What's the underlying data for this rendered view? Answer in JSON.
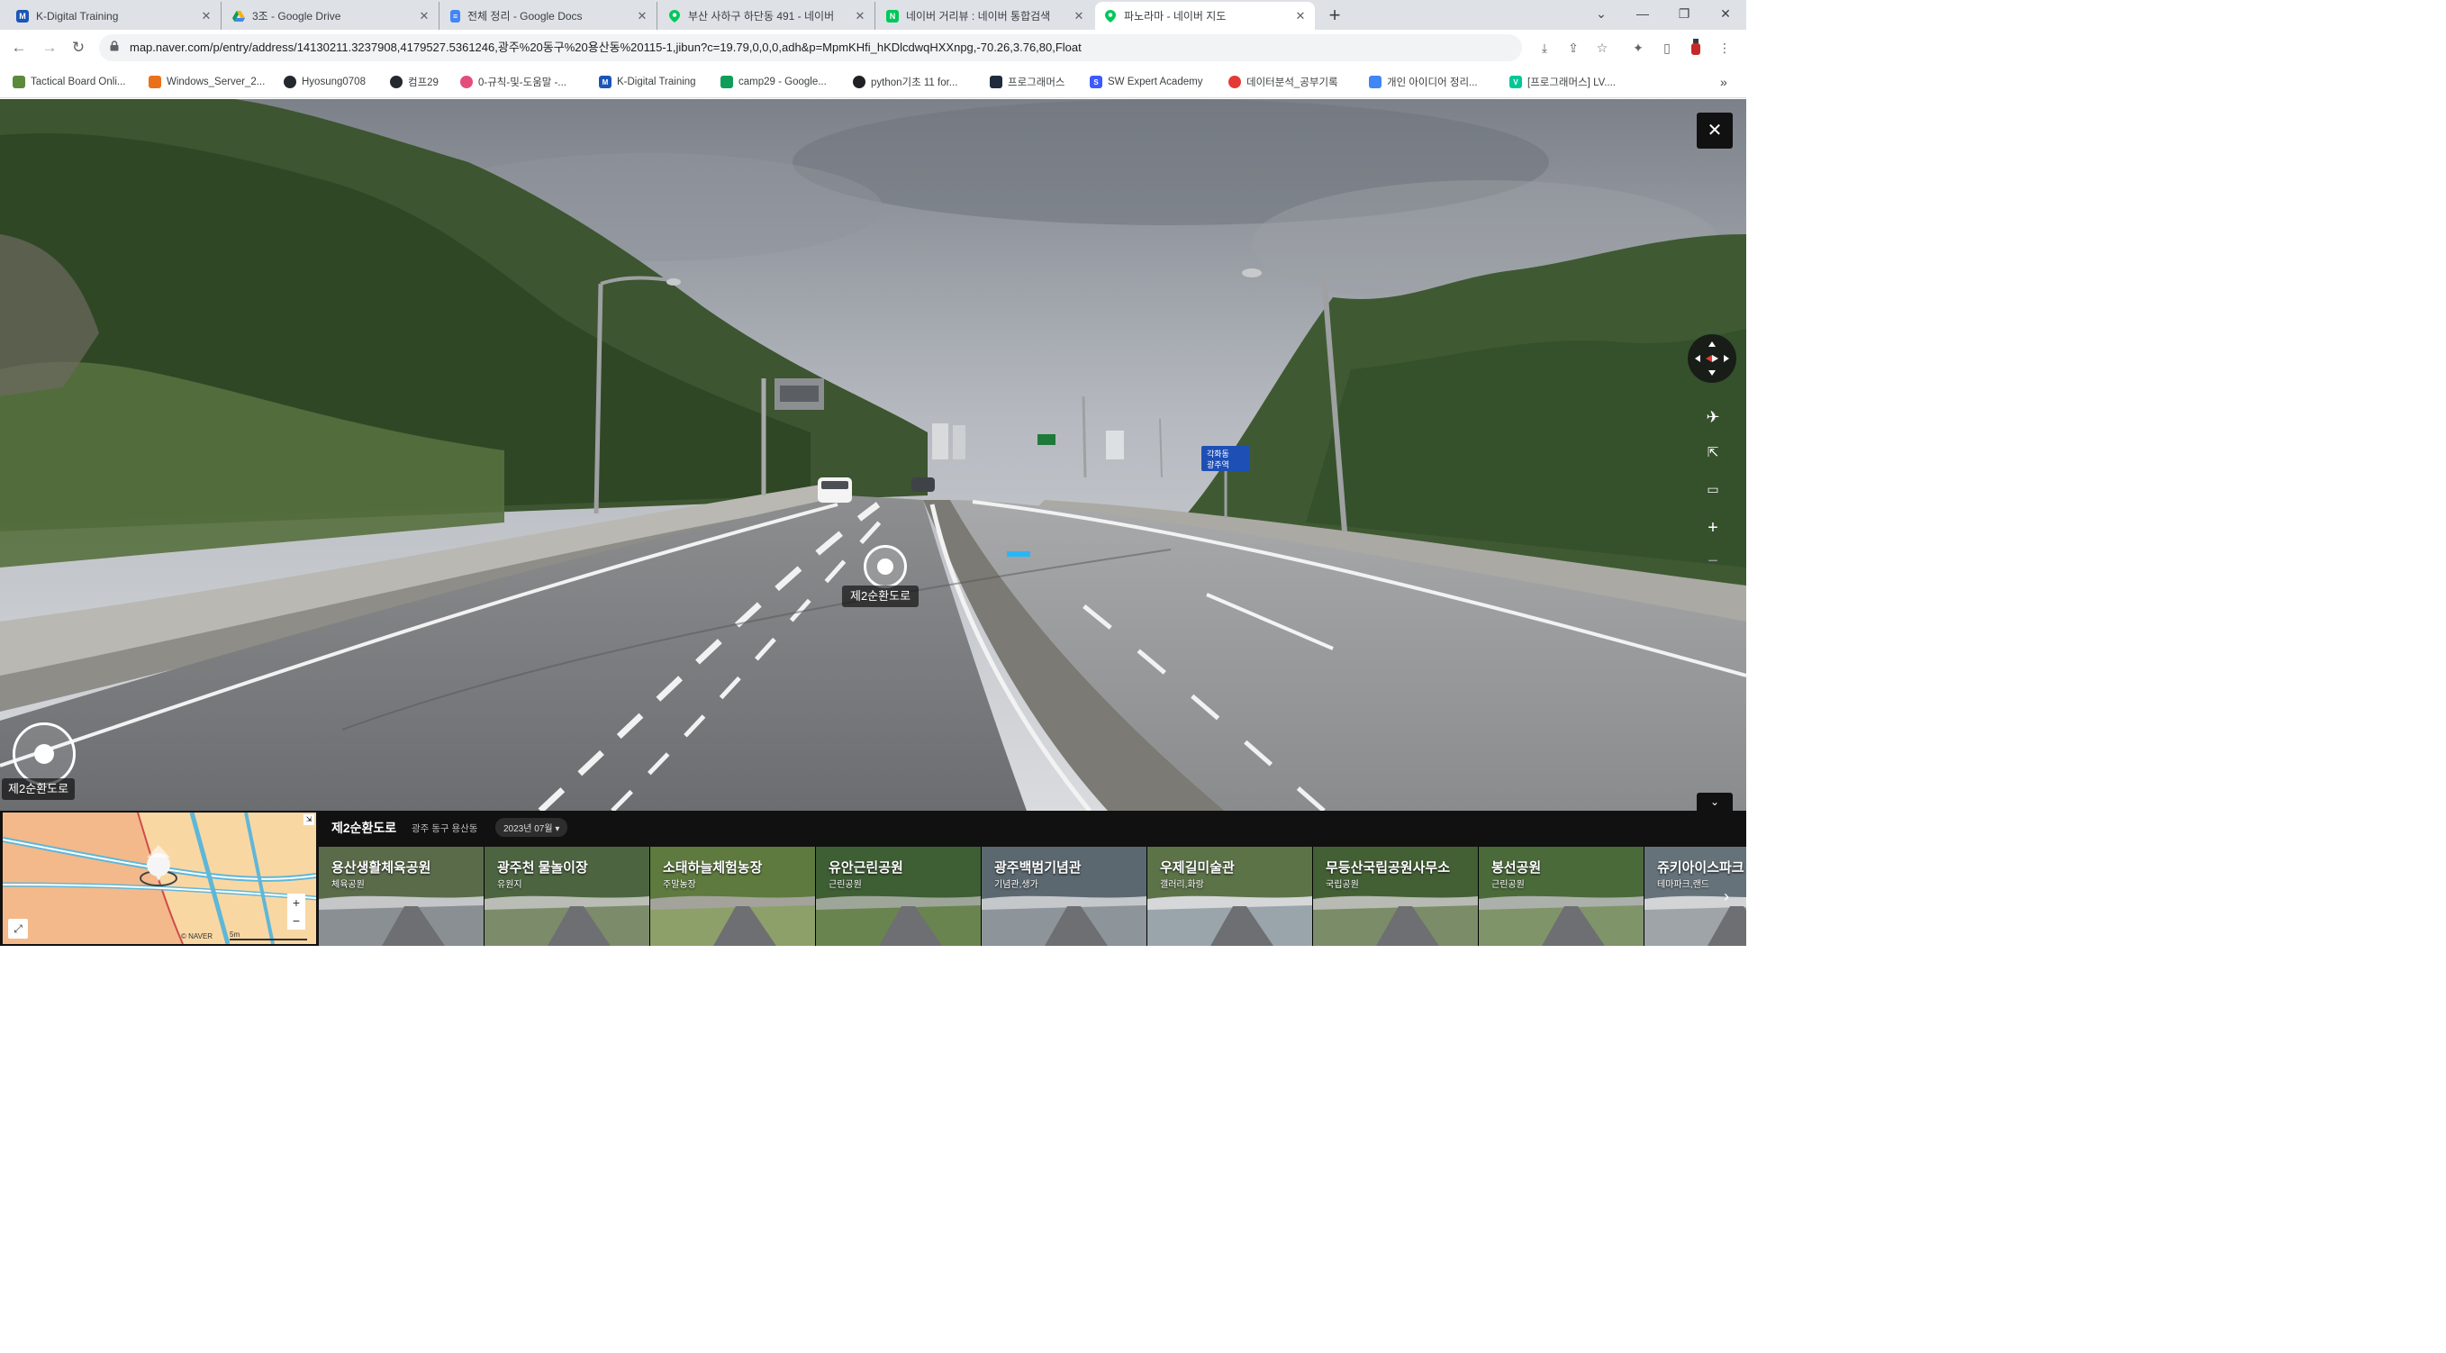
{
  "browser": {
    "tabs": [
      {
        "title": "K-Digital Training",
        "favicon": "k-digital-logo",
        "color": "#1a56b6",
        "letter": "M"
      },
      {
        "title": "3조 - Google Drive",
        "favicon": "google-drive-logo",
        "color": "#f6b400",
        "letter": ""
      },
      {
        "title": "전체 정리 - Google Docs",
        "favicon": "google-docs-logo",
        "color": "#4285f4",
        "letter": ""
      },
      {
        "title": "부산 사하구 하단동 491 - 네이버",
        "favicon": "naver-map-logo",
        "color": "#03c75a",
        "letter": ""
      },
      {
        "title": "네이버 거리뷰 : 네이버 통합검색",
        "favicon": "naver-logo",
        "color": "#03c75a",
        "letter": "N"
      },
      {
        "title": "파노라마 - 네이버 지도",
        "favicon": "naver-map-logo",
        "color": "#03c75a",
        "letter": ""
      }
    ],
    "url": "map.naver.com/p/entry/address/14130211.3237908,4179527.5361246,광주%20동구%20용산동%20115-1,jibun?c=19.79,0,0,0,adh&p=MpmKHfi_hKDlcdwqHXXnpg,-70.26,3.76,80,Float",
    "bookmarks": [
      {
        "label": "Tactical Board Onli...",
        "color": "#5c8a3c"
      },
      {
        "label": "Windows_Server_2...",
        "color": "#e8711a"
      },
      {
        "label": "Hyosung0708",
        "color": "#24292f"
      },
      {
        "label": "컴프29",
        "color": "#24292f"
      },
      {
        "label": "0-규칙-및-도움말 -...",
        "color": "#e44d7b"
      },
      {
        "label": "K-Digital Training",
        "color": "#1a56b6"
      },
      {
        "label": "camp29 - Google...",
        "color": "#0f9d58"
      },
      {
        "label": "python기초 11 for...",
        "color": "#202124"
      },
      {
        "label": "프로그래머스",
        "color": "#202b3d"
      },
      {
        "label": "SW Expert Academy",
        "color": "#3d5afe"
      },
      {
        "label": "데이터분석_공부기록",
        "color": "#e53935"
      },
      {
        "label": "개인 아이디어 정리...",
        "color": "#4285f4"
      },
      {
        "label": "[프로그래머스] LV....",
        "color": "#00c896"
      }
    ]
  },
  "panorama": {
    "road_label": "제2순환도로",
    "corner_label": "제2순환도로",
    "sign_text_1": "각화동",
    "sign_text_2": "광주역"
  },
  "info": {
    "road_name": "제2순환도로",
    "address": "광주 동구 용산동",
    "date": "2023년 07월 ▾",
    "map_credit": "© NAVER",
    "scale": "5m",
    "places": [
      {
        "name": "용산생활체육공원",
        "category": "체육공원"
      },
      {
        "name": "광주천 물놀이장",
        "category": "유원지"
      },
      {
        "name": "소태하늘체험농장",
        "category": "주말농장"
      },
      {
        "name": "유안근린공원",
        "category": "근린공원"
      },
      {
        "name": "광주백범기념관",
        "category": "기념관,생가"
      },
      {
        "name": "우제길미술관",
        "category": "갤러리,화랑"
      },
      {
        "name": "무등산국립공원사무소",
        "category": "국립공원"
      },
      {
        "name": "봉선공원",
        "category": "근린공원"
      },
      {
        "name": "쥬키아이스파크",
        "category": "테마파크,랜드"
      }
    ]
  }
}
